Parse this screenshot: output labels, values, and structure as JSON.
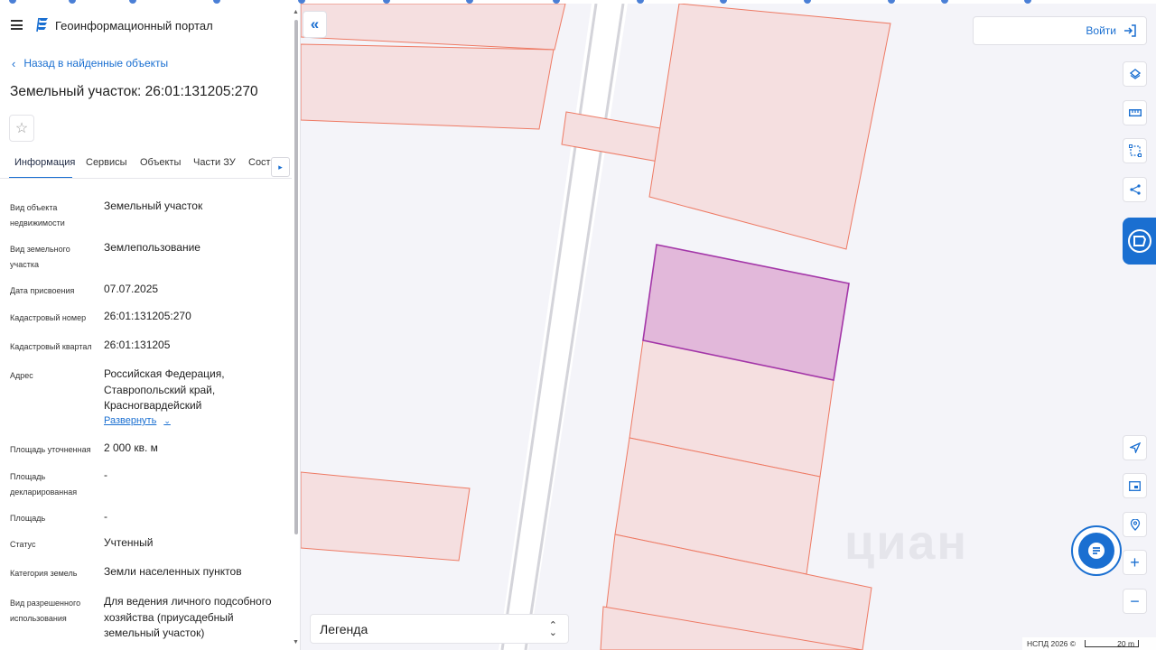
{
  "header": {
    "portal_title": "Геоинформационный портал"
  },
  "nav": {
    "back_label": "Назад в найденные объекты"
  },
  "object": {
    "title": "Земельный участок: 26:01:131205:270"
  },
  "tabs": [
    {
      "label": "Информация",
      "active": true
    },
    {
      "label": "Сервисы"
    },
    {
      "label": "Объекты"
    },
    {
      "label": "Части ЗУ"
    },
    {
      "label": "Соста"
    }
  ],
  "properties": [
    {
      "label": "Вид объекта недвижимости",
      "value": "Земельный участок"
    },
    {
      "label": "Вид земельного участка",
      "value": "Землепользование"
    },
    {
      "label": "Дата присвоения",
      "value": "07.07.2025"
    },
    {
      "label": "Кадастровый номер",
      "value": "26:01:131205:270"
    },
    {
      "label": "Кадастровый квартал",
      "value": "26:01:131205"
    },
    {
      "label": "Адрес",
      "value": "Российская Федерация, Ставропольский край, Красногвардейский муниципальный"
    },
    {
      "label": "Площадь уточненная",
      "value": "2 000 кв. м"
    },
    {
      "label": "Площадь декларированная",
      "value": "-"
    },
    {
      "label": "Площадь",
      "value": "-"
    },
    {
      "label": "Статус",
      "value": "Учтенный"
    },
    {
      "label": "Категория земель",
      "value": "Земли населенных пунктов"
    },
    {
      "label": "Вид разрешенного использования",
      "value": "Для ведения личного подсобного хозяйства (приусадебный земельный участок)"
    }
  ],
  "address_expand_label": "Развернуть",
  "map": {
    "login_label": "Войти",
    "legend_label": "Легенда",
    "attribution": "НСПД 2026 ©",
    "scale_label": "20 m",
    "watermark": "циан",
    "colors": {
      "parcel_fill": "#f5dfe0",
      "parcel_stroke": "#ee7a64",
      "selected_fill": "#e2b8da",
      "selected_stroke": "#a336a8",
      "accent": "#1a6fd1"
    },
    "toolbar_icons": [
      "layers-icon",
      "ruler-icon",
      "area-select-icon",
      "share-icon",
      "locate-icon",
      "minimap-icon",
      "geo-search-icon",
      "zoom-in-icon",
      "zoom-out-icon"
    ]
  }
}
